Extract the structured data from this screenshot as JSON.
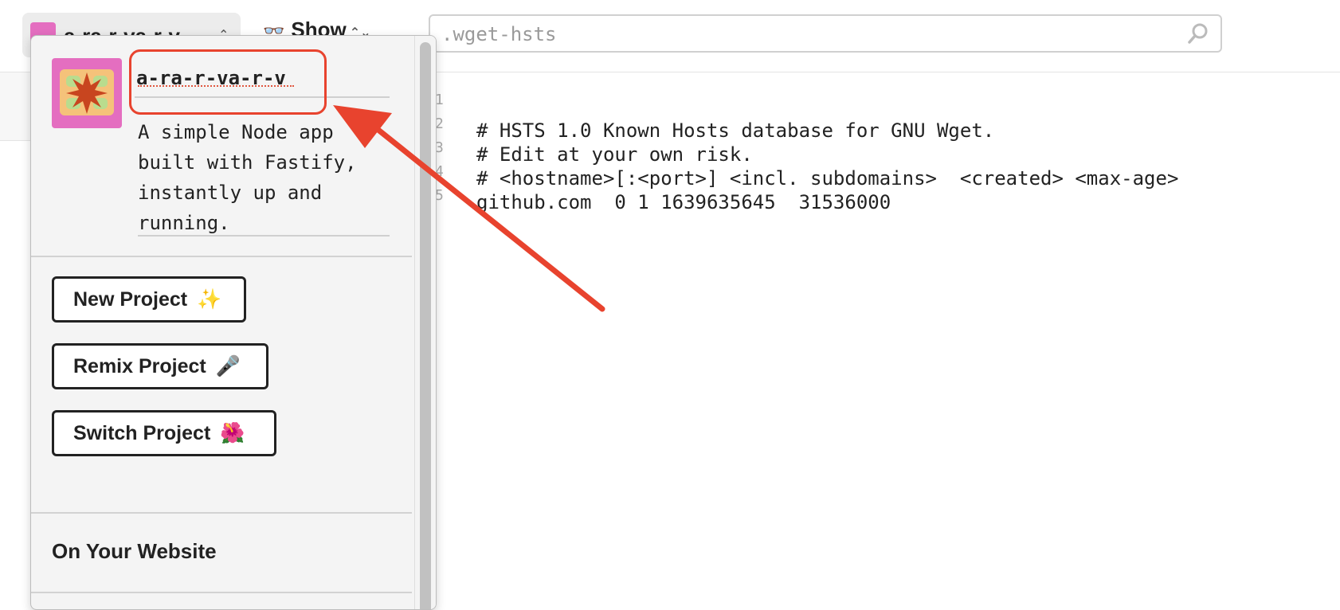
{
  "topbar": {
    "project_name": "a-ra-r-va-r-v",
    "show_label": "Show",
    "search": {
      "value": "",
      "placeholder": ".wget-hsts",
      "icon": "search-icon"
    }
  },
  "popover": {
    "project_name": "a-ra-r-va-r-v",
    "description": "A simple Node app\nbuilt with Fastify,\ninstantly up and\nrunning.",
    "buttons": [
      {
        "label": "New Project",
        "emoji": "✨"
      },
      {
        "label": "Remix Project",
        "emoji": "🎤"
      },
      {
        "label": "Switch Project",
        "emoji": "🌺"
      }
    ],
    "section_heading": "On Your Website"
  },
  "editor": {
    "lines": [
      {
        "num": "1",
        "text": "# HSTS 1.0 Known Hosts database for GNU Wget."
      },
      {
        "num": "2",
        "text": "# Edit at your own risk."
      },
      {
        "num": "3",
        "text": "# <hostname>[:<port>] <incl. subdomains>  <created> <max-age>"
      },
      {
        "num": "4",
        "text": "github.com  0 1 1639635645  31536000"
      },
      {
        "num": "5",
        "text": ""
      }
    ]
  },
  "annotation": {
    "color": "#e8432e"
  },
  "colors": {
    "avatar_bg": "#e46ec0",
    "avatar_tile": "#f5c27a",
    "avatar_star": "#c8451f",
    "avatar_leaf": "#b9dc8e"
  }
}
